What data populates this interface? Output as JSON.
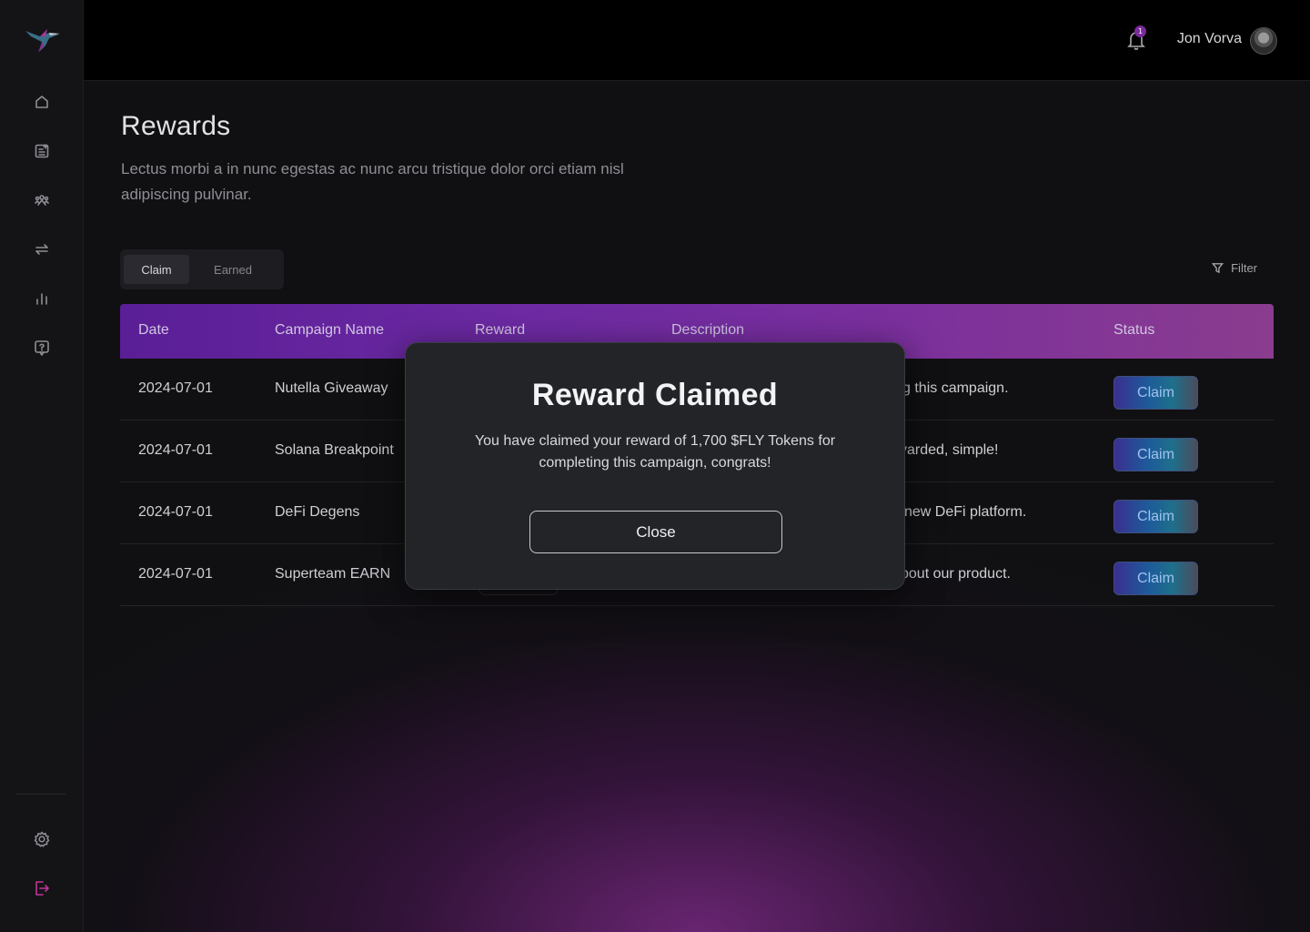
{
  "user": {
    "name": "Jon Vorva",
    "notification_count": "1"
  },
  "page": {
    "title": "Rewards",
    "description": "Lectus morbi a in nunc egestas ac nunc arcu tristique dolor orci etiam nisl adipiscing pulvinar."
  },
  "tabs": [
    {
      "label": "Claim",
      "active": true
    },
    {
      "label": "Earned",
      "active": false
    }
  ],
  "filter_label": "Filter",
  "table": {
    "columns": [
      "Date",
      "Campaign Name",
      "Reward",
      "Description",
      "Status"
    ],
    "rows": [
      {
        "date": "2024-07-01",
        "campaign": "Nutella Giveaway",
        "description_visible": "g this campaign.",
        "status": "Claim"
      },
      {
        "date": "2024-07-01",
        "campaign": "Solana Breakpoint",
        "description_visible": "varded, simple!",
        "status": "Claim"
      },
      {
        "date": "2024-07-01",
        "campaign": "DeFi Degens",
        "description_visible": "new DeFi platform.",
        "status": "Claim"
      },
      {
        "date": "2024-07-01",
        "campaign": "Superteam EARN",
        "description_visible": "bout our product.",
        "status": "Claim"
      }
    ]
  },
  "modal": {
    "title": "Reward Claimed",
    "message": "You have claimed your reward of 1,700 $FLY Tokens for completing this campaign, congrats!",
    "close_label": "Close"
  },
  "colors": {
    "accent_purple": "#6d2aa3",
    "logout_icon": "#c0359a",
    "claim_text": "#9fc3ef"
  },
  "icons": {
    "sidebar": [
      "home-icon",
      "document-add-icon",
      "people-icon",
      "transfer-icon",
      "chart-icon",
      "help-icon",
      "settings-icon",
      "logout-icon"
    ],
    "topbar": [
      "bell-icon"
    ]
  }
}
